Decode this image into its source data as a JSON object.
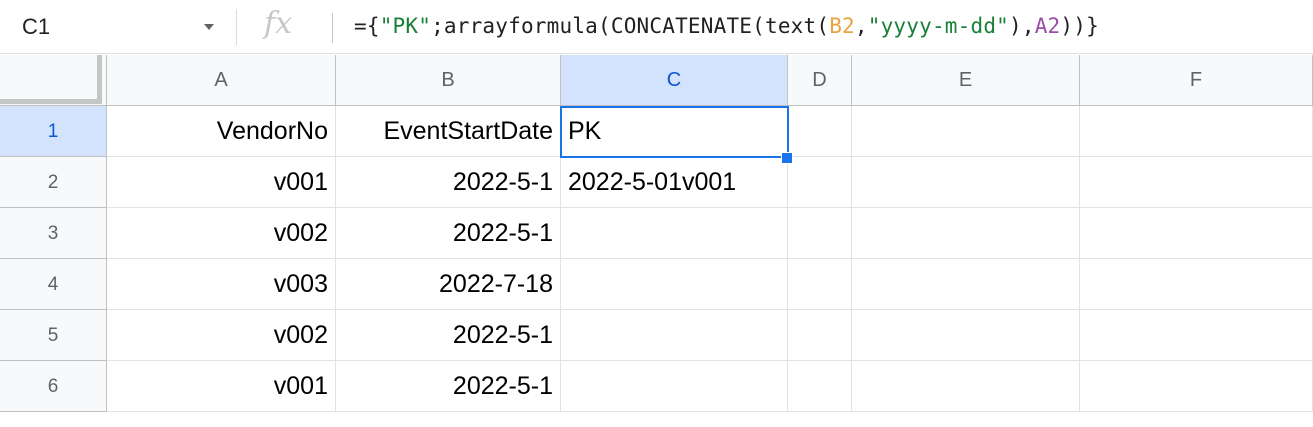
{
  "name_box": {
    "value": "C1",
    "dropdown_icon": "chevron-down-icon"
  },
  "formula_bar": {
    "fx_icon": "fx",
    "formula_parts": [
      {
        "text": "={",
        "kind": "plain"
      },
      {
        "text": "\"PK\"",
        "kind": "string"
      },
      {
        "text": ";arrayformula(CONCATENATE(text(",
        "kind": "plain"
      },
      {
        "text": "B2",
        "kind": "ref-b"
      },
      {
        "text": ",",
        "kind": "plain"
      },
      {
        "text": "\"yyyy-m-dd\"",
        "kind": "string"
      },
      {
        "text": "),",
        "kind": "plain"
      },
      {
        "text": "A2",
        "kind": "ref-a"
      },
      {
        "text": "))}",
        "kind": "plain"
      }
    ]
  },
  "columns": [
    "A",
    "B",
    "C",
    "D",
    "E",
    "F"
  ],
  "rows": [
    "1",
    "2",
    "3",
    "4",
    "5",
    "6"
  ],
  "cells": [
    [
      "VendorNo",
      "EventStartDate",
      "PK",
      "",
      "",
      ""
    ],
    [
      "v001",
      "2022-5-1",
      "2022-5-01v001",
      "",
      "",
      ""
    ],
    [
      "v002",
      "2022-5-1",
      "",
      "",
      "",
      ""
    ],
    [
      "v003",
      "2022-7-18",
      "",
      "",
      "",
      ""
    ],
    [
      "v002",
      "2022-5-1",
      "",
      "",
      "",
      ""
    ],
    [
      "v001",
      "2022-5-1",
      "",
      "",
      "",
      ""
    ]
  ],
  "selected_cell": "C1",
  "colors": {
    "selection": "#1a73e8",
    "header_bg": "#f8f9fa",
    "string": "#188038",
    "ref_b": "#e8a33d",
    "ref_a": "#9c4ba8"
  }
}
